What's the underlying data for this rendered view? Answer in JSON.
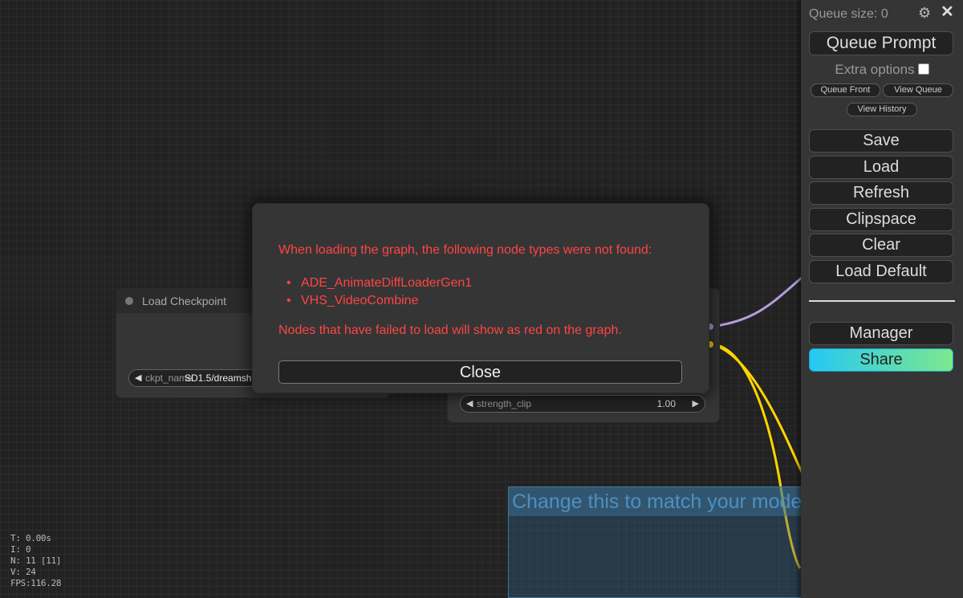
{
  "menu": {
    "queue_size": "Queue size: 0",
    "queue_prompt": "Queue Prompt",
    "extra_options": "Extra options",
    "queue_front": "Queue Front",
    "view_queue": "View Queue",
    "view_history": "View History",
    "save": "Save",
    "load": "Load",
    "refresh": "Refresh",
    "clipspace": "Clipspace",
    "clear": "Clear",
    "load_default": "Load Default",
    "manager": "Manager",
    "share": "Share",
    "gear_icon": "gear-icon",
    "close_icon": "close-icon",
    "extra_options_checked": false
  },
  "dialog": {
    "message": "When loading the graph, the following node types were not found:",
    "missing_nodes": [
      "ADE_AnimateDiffLoaderGen1",
      "VHS_VideoCombine"
    ],
    "footer": "Nodes that have failed to load will show as red on the graph.",
    "close_label": "Close"
  },
  "nodes": {
    "load_checkpoint": {
      "title": "Load Checkpoint",
      "widget_label": "ckpt_name",
      "widget_value": "SD1.5/dreamsh"
    },
    "lora": {
      "widget_label": "strength_clip",
      "widget_value": "1.00"
    }
  },
  "group": {
    "title": "Change this to match your model"
  },
  "stats": {
    "t": "T: 0.00s",
    "i": "I: 0",
    "n": "N: 11 [11]",
    "v": "V: 24",
    "fps": "FPS:116.28"
  },
  "colors": {
    "error_text": "#ff4444",
    "link_model": "#b39ddb",
    "link_clip": "#ffd500",
    "share_gradient": [
      "#25c8f3",
      "#7de88d"
    ]
  }
}
